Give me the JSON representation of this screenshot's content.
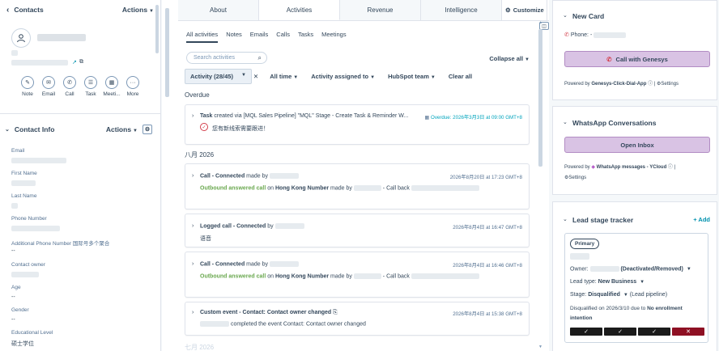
{
  "left": {
    "header": {
      "back_label": "Contacts",
      "actions_label": "Actions"
    },
    "quick_actions": [
      {
        "label": "Note",
        "icon": "note-icon"
      },
      {
        "label": "Email",
        "icon": "email-icon"
      },
      {
        "label": "Call",
        "icon": "phone-icon"
      },
      {
        "label": "Task",
        "icon": "task-icon"
      },
      {
        "label": "Meeti...",
        "icon": "calendar-icon"
      },
      {
        "label": "More",
        "icon": "more-icon"
      }
    ],
    "contact_info": {
      "title": "Contact Info",
      "actions_label": "Actions",
      "fields": [
        {
          "label": "Email",
          "value": ""
        },
        {
          "label": "First Name",
          "value": ""
        },
        {
          "label": "Last Name",
          "value": ""
        },
        {
          "label": "Phone Number",
          "value": ""
        },
        {
          "label": "Additional Phone Number 国际号多个聚合",
          "value": "--"
        },
        {
          "label": "Contact owner",
          "value": ""
        },
        {
          "label": "Age",
          "value": "--"
        },
        {
          "label": "Gender",
          "value": "--"
        },
        {
          "label": "Educational Level",
          "value": "硕士学位"
        }
      ]
    }
  },
  "mid": {
    "tabs": [
      "About",
      "Activities",
      "Revenue",
      "Intelligence"
    ],
    "customize_label": "Customize",
    "subtabs": [
      "All activities",
      "Notes",
      "Emails",
      "Calls",
      "Tasks",
      "Meetings"
    ],
    "search_placeholder": "Search activities",
    "collapse_label": "Collapse all",
    "filters": {
      "activity_chip": "Activity (28/45)",
      "all_time": "All time",
      "assigned": "Activity assigned to",
      "team": "HubSpot team",
      "clear": "Clear all"
    },
    "sections": {
      "overdue": "Overdue",
      "month": "八月 2026",
      "next": "七月 2026"
    },
    "task": {
      "prefix": "Task",
      "text": " created via [MQL Sales Pipeline] \"MQL\" Stage - Create Task & Reminder W...",
      "due": "Overdue: 2026年3月3日 at 09:00 GMT+8",
      "body": "您有新线索需要跟进！"
    },
    "activities": [
      {
        "title": "Call - Connected",
        "by": " made by",
        "time": "2026年8月20日 at 17:23 GMT+8",
        "outcome": "Outbound answered call",
        "on": " on ",
        "number": "Hong Kong Number",
        "made_by": " made by",
        "callback": " - Call back"
      },
      {
        "title": "Logged call - Connected",
        "by": " by",
        "time": "2026年8月4日 at 16:47 GMT+8",
        "body": "语音"
      },
      {
        "title": "Call - Connected",
        "by": " made by",
        "time": "2026年8月4日 at 16:46 GMT+8",
        "outcome": "Outbound answered call",
        "on": " on ",
        "number": "Hong Kong Number",
        "made_by": " made by",
        "callback": " - Call back"
      },
      {
        "title": "Custom event - Contact: Contact owner changed",
        "time": "2026年8月4日 at 15:38 GMT+8",
        "body": " completed the event Contact: Contact owner changed"
      }
    ]
  },
  "right": {
    "new_card": {
      "title": "New Card",
      "phone_label": "Phone: -",
      "button": "Call with Genesys",
      "powered_prefix": "Powered by",
      "powered_app": "Genesys-Click-Dial-App",
      "settings": "Settings"
    },
    "whatsapp": {
      "title": "WhatsApp Conversations",
      "button": "Open Inbox",
      "powered_prefix": "Powered by",
      "powered_app": "WhatsApp messages - YCloud",
      "settings": "Settings"
    },
    "lead_tracker": {
      "title": "Lead stage tracker",
      "add": "+ Add",
      "badge": "Primary",
      "owner_label": "Owner:",
      "owner_status": "(Deactivated/Removed)",
      "lead_type_label": "Lead type:",
      "lead_type_value": "New Business",
      "stage_label": "Stage:",
      "stage_value": "Disqualified",
      "stage_pipeline": "(Lead pipeline)",
      "disq_prefix": "Disqualified on 2026/3/10 due to",
      "disq_reason": "No enrollment",
      "disq_reason2": "intention",
      "stages_done": 3,
      "stages_total": 4
    }
  }
}
